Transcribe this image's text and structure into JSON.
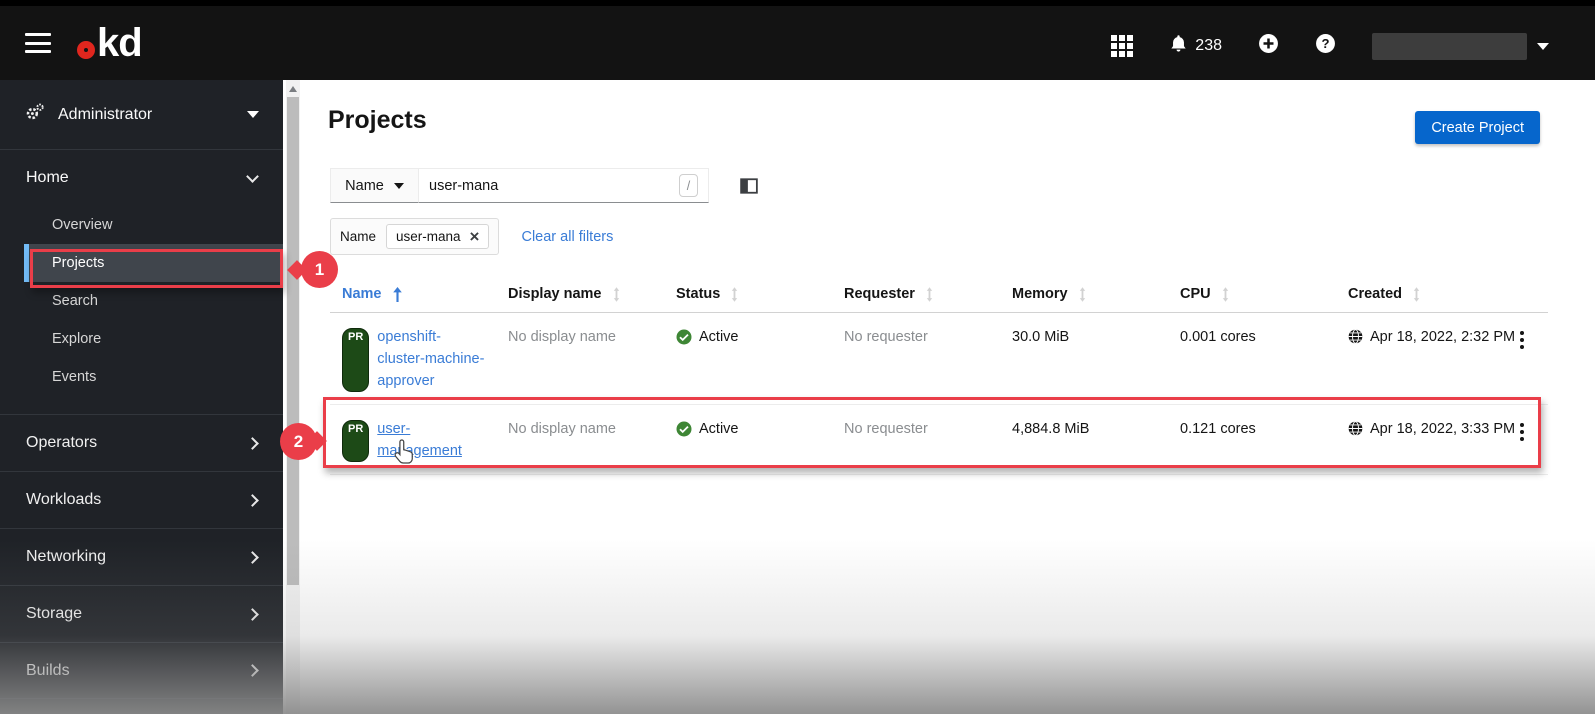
{
  "masthead": {
    "logo": "kd",
    "notification_count": "238"
  },
  "sidebar": {
    "perspective": "Administrator",
    "home": {
      "label": "Home",
      "items": [
        "Overview",
        "Projects",
        "Search",
        "Explore",
        "Events"
      ],
      "active_item": "Projects"
    },
    "groups": [
      "Operators",
      "Workloads",
      "Networking",
      "Storage",
      "Builds"
    ]
  },
  "page": {
    "title": "Projects",
    "create_button": "Create Project"
  },
  "filter": {
    "attribute": "Name",
    "query": "user-mana",
    "shortcut_hint": "/",
    "chip_label": "Name",
    "chip_value": "user-mana",
    "clear_all": "Clear all filters"
  },
  "table": {
    "columns": [
      "Name",
      "Display name",
      "Status",
      "Requester",
      "Memory",
      "CPU",
      "Created"
    ],
    "sort": {
      "column": "Name",
      "direction": "ascending"
    },
    "rows": [
      {
        "badge": "PR",
        "name": "openshift-cluster-machine-approver",
        "name_lines": [
          "openshift-",
          "cluster-machine-",
          "approver"
        ],
        "display_name": "No display name",
        "status": "Active",
        "requester": "No requester",
        "memory": "30.0 MiB",
        "cpu": "0.001 cores",
        "created": "Apr 18, 2022, 2:32 PM"
      },
      {
        "badge": "PR",
        "name": "user-management",
        "name_lines": [
          "user-",
          "management"
        ],
        "display_name": "No display name",
        "status": "Active",
        "requester": "No requester",
        "memory": "4,884.8 MiB",
        "cpu": "0.121 cores",
        "created": "Apr 18, 2022, 3:33 PM"
      }
    ]
  },
  "annotations": {
    "step1": "1",
    "step2": "2"
  },
  "icons": {
    "help": "?",
    "close_chip": "×"
  },
  "colors": {
    "masthead_bg": "#131313",
    "sidebar_bg": "#1f2227",
    "active_nav_bar": "#73bcf7",
    "link_blue": "#3a7cd6",
    "primary_button": "#0666cc",
    "annotation_red": "#ea3e49",
    "status_success_green": "#3e8635",
    "project_badge_green": "#1d4a17"
  }
}
